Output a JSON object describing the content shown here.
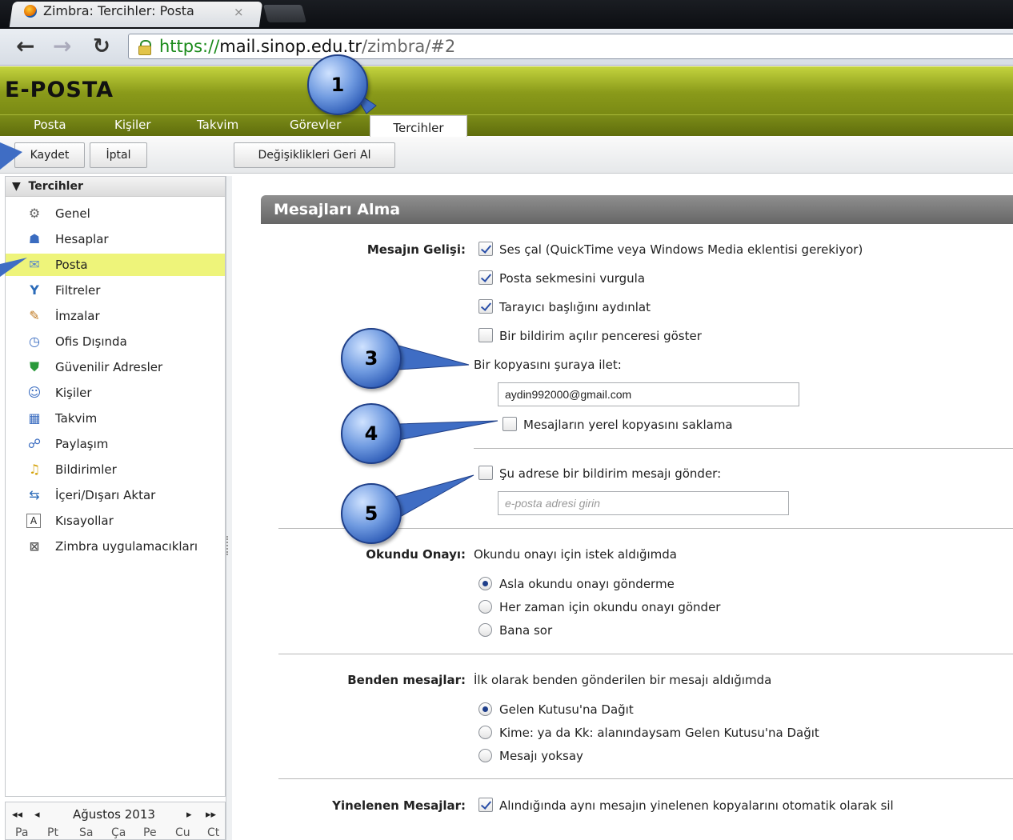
{
  "browser": {
    "tab_title": "Zimbra: Tercihler: Posta",
    "tab_close": "×",
    "url_https": "https://",
    "url_host": "mail.sinop.edu.tr",
    "url_path": "/zimbra/#2"
  },
  "app": {
    "logo": "E-POSTA",
    "tabs": [
      {
        "label": "Posta"
      },
      {
        "label": "Kişiler"
      },
      {
        "label": "Takvim"
      },
      {
        "label": "Görevler"
      },
      {
        "label": "Tercihler",
        "active": true
      }
    ]
  },
  "toolbar": {
    "save": "Kaydet",
    "cancel": "İptal",
    "revert": "Değişiklikleri Geri Al"
  },
  "sidebar": {
    "header": "Tercihler",
    "items": [
      {
        "label": "Genel",
        "icon": "gear-icon"
      },
      {
        "label": "Hesaplar",
        "icon": "accounts-icon"
      },
      {
        "label": "Posta",
        "icon": "mail-icon",
        "selected": true
      },
      {
        "label": "Filtreler",
        "icon": "filter-icon"
      },
      {
        "label": "İmzalar",
        "icon": "signature-icon"
      },
      {
        "label": "Ofis Dışında",
        "icon": "out-of-office-icon"
      },
      {
        "label": "Güvenilir Adresler",
        "icon": "shield-icon"
      },
      {
        "label": "Kişiler",
        "icon": "contact-icon"
      },
      {
        "label": "Takvim",
        "icon": "calendar-icon"
      },
      {
        "label": "Paylaşım",
        "icon": "sharing-icon"
      },
      {
        "label": "Bildirimler",
        "icon": "bell-icon"
      },
      {
        "label": "İçeri/Dışarı Aktar",
        "icon": "import-export-icon"
      },
      {
        "label": "Kısayollar",
        "icon": "shortcut-icon"
      },
      {
        "label": "Zimbra uygulamacıkları",
        "icon": "zimlet-icon"
      }
    ]
  },
  "calendar": {
    "month": "Ağustos 2013",
    "days": [
      "Pa",
      "Pt",
      "Sa",
      "Ça",
      "Pe",
      "Cu",
      "Ct"
    ]
  },
  "section": {
    "title": "Mesajları Alma",
    "arrival_label": "Mesajın Gelişi:",
    "arrival_options": [
      {
        "label": "Ses çal (QuickTime veya Windows Media eklentisi gerekiyor)",
        "checked": true
      },
      {
        "label": "Posta sekmesini vurgula",
        "checked": true
      },
      {
        "label": "Tarayıcı başlığını aydınlat",
        "checked": true
      },
      {
        "label": "Bir bildirim açılır penceresi göster",
        "checked": false
      }
    ],
    "forward_label": "Bir kopyasını şuraya ilet:",
    "forward_value": "aydin992000@gmail.com",
    "no_local_copy": "Mesajların yerel kopyasını saklama",
    "notify_label": "Şu adrese bir bildirim mesajı gönder:",
    "notify_placeholder": "e-posta adresi girin",
    "read_receipt_label": "Okundu Onayı:",
    "read_receipt_desc": "Okundu onayı için istek aldığımda",
    "read_receipt_options": [
      {
        "label": "Asla okundu onayı gönderme",
        "selected": true
      },
      {
        "label": "Her zaman için okundu onayı gönder",
        "selected": false
      },
      {
        "label": "Bana sor",
        "selected": false
      }
    ],
    "from_me_label": "Benden mesajlar:",
    "from_me_desc": "İlk olarak benden gönderilen bir mesajı aldığımda",
    "from_me_options": [
      {
        "label": "Gelen Kutusu'na Dağıt",
        "selected": true
      },
      {
        "label": "Kime: ya da Kk: alanındaysam Gelen Kutusu'na Dağıt",
        "selected": false
      },
      {
        "label": "Mesajı yoksay",
        "selected": false
      }
    ],
    "duplicates_label": "Yinelenen Mesajlar:",
    "duplicates_option": "Alındığında aynı mesajın yinelenen kopyalarını otomatik olarak sil"
  },
  "callouts": [
    "1",
    "3",
    "4",
    "5"
  ]
}
